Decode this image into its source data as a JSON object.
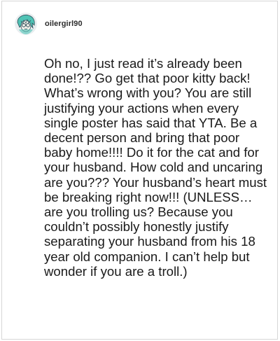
{
  "comment": {
    "username": "oilergirl90",
    "avatar_icon": "teal-cartoon-character-avatar-icon",
    "text": "Oh no, I just read it’s already been done!?? Go get that poor kitty back! What’s wrong with you? You are still justifying your actions when every single poster has said that YTA. Be a decent person and bring that poor baby home!!!! Do it for the cat and for your husband. How cold and uncaring are you??? Your husband’s heart must be breaking right now!!! (UNLESS… are you trolling us? Because you couldn’t possibly honestly justify separating your husband from his 18 year old companion. I can’t help but wonder if you are a troll.)"
  },
  "colors": {
    "avatar_teal": "#4fc3b5",
    "avatar_dark": "#2f4f5a",
    "text": "#1a1a1a",
    "border": "#d6d6d6"
  }
}
